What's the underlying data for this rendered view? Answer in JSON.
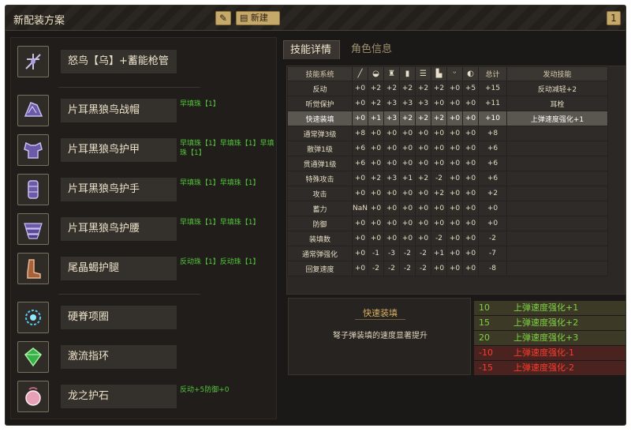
{
  "window": {
    "title": "新配装方案",
    "new_label": "新建",
    "count": "1"
  },
  "equipment": [
    {
      "name": "怒鸟【乌】+蓄能枪管",
      "deco": "",
      "icon": "weapon-bowgun-icon"
    },
    {
      "name": "片耳黑狼鸟战帽",
      "deco": "早填珠【1】",
      "icon": "helm-icon"
    },
    {
      "name": "片耳黑狼鸟护甲",
      "deco": "早填珠【1】早填珠【1】早填珠【1】",
      "icon": "chest-icon"
    },
    {
      "name": "片耳黑狼鸟护手",
      "deco": "早填珠【1】早填珠【1】",
      "icon": "arms-icon"
    },
    {
      "name": "片耳黑狼鸟护腰",
      "deco": "早填珠【1】早填珠【1】",
      "icon": "waist-icon"
    },
    {
      "name": "尾晶蝎护腿",
      "deco": "反动珠【1】反动珠【1】",
      "icon": "legs-icon"
    },
    {
      "name": "硬脊项圈",
      "deco": "",
      "icon": "necklace-icon"
    },
    {
      "name": "激流指环",
      "deco": "",
      "icon": "ring-icon"
    },
    {
      "name": "龙之护石",
      "deco": "反动+5防御+0",
      "icon": "talisman-icon"
    }
  ],
  "tabs": {
    "skill_details": "技能详情",
    "char_info": "角色信息"
  },
  "table": {
    "headers": {
      "skill_system": "技能系统",
      "total": "总计",
      "activated": "发动技能"
    },
    "header_icons": [
      "weapon-icon",
      "helm-icon",
      "chest-icon",
      "arms-icon",
      "waist-icon",
      "legs-icon",
      "necklace-icon",
      "ring-icon"
    ],
    "rows": [
      {
        "skill": "反动",
        "vals": [
          "+0",
          "+2",
          "+2",
          "+2",
          "+2",
          "+2",
          "+0",
          "+5"
        ],
        "total": "+15",
        "active": "反动减轻+2",
        "selected": false
      },
      {
        "skill": "听觉保护",
        "vals": [
          "+0",
          "+2",
          "+3",
          "+3",
          "+3",
          "+0",
          "+0",
          "+0"
        ],
        "total": "+11",
        "active": "耳栓",
        "selected": false
      },
      {
        "skill": "快速装填",
        "vals": [
          "+0",
          "+1",
          "+3",
          "+2",
          "+2",
          "+2",
          "+0",
          "+0"
        ],
        "total": "+10",
        "active": "上弹速度强化+1",
        "selected": true
      },
      {
        "skill": "通常弹3级",
        "vals": [
          "+8",
          "+0",
          "+0",
          "+0",
          "+0",
          "+0",
          "+0",
          "+0"
        ],
        "total": "+8",
        "active": "",
        "selected": false
      },
      {
        "skill": "散弹1级",
        "vals": [
          "+6",
          "+0",
          "+0",
          "+0",
          "+0",
          "+0",
          "+0",
          "+0"
        ],
        "total": "+6",
        "active": "",
        "selected": false
      },
      {
        "skill": "贯通弹1级",
        "vals": [
          "+6",
          "+0",
          "+0",
          "+0",
          "+0",
          "+0",
          "+0",
          "+0"
        ],
        "total": "+6",
        "active": "",
        "selected": false
      },
      {
        "skill": "特殊攻击",
        "vals": [
          "+0",
          "+2",
          "+3",
          "+1",
          "+2",
          "-2",
          "+0",
          "+0"
        ],
        "total": "+6",
        "active": "",
        "selected": false
      },
      {
        "skill": "攻击",
        "vals": [
          "+0",
          "+0",
          "+0",
          "+0",
          "+0",
          "+2",
          "+0",
          "+0"
        ],
        "total": "+2",
        "active": "",
        "selected": false
      },
      {
        "skill": "蓄力",
        "vals": [
          "NaN",
          "+0",
          "+0",
          "+0",
          "+0",
          "+0",
          "+0",
          "+0"
        ],
        "total": "+0",
        "active": "",
        "selected": false
      },
      {
        "skill": "防御",
        "vals": [
          "+0",
          "+0",
          "+0",
          "+0",
          "+0",
          "+0",
          "+0",
          "+0"
        ],
        "total": "+0",
        "active": "",
        "selected": false
      },
      {
        "skill": "装填数",
        "vals": [
          "+0",
          "+0",
          "+0",
          "+0",
          "+0",
          "-2",
          "+0",
          "+0"
        ],
        "total": "-2",
        "active": "",
        "selected": false
      },
      {
        "skill": "通常弹强化",
        "vals": [
          "+0",
          "-1",
          "-3",
          "-2",
          "-2",
          "+1",
          "+0",
          "+0"
        ],
        "total": "-7",
        "active": "",
        "selected": false
      },
      {
        "skill": "回复速度",
        "vals": [
          "+0",
          "-2",
          "-2",
          "-2",
          "-2",
          "+0",
          "+0",
          "+0"
        ],
        "total": "-8",
        "active": "",
        "selected": false
      }
    ]
  },
  "detail": {
    "title": "快速装填",
    "desc": "弩子弹装填的速度显著提升"
  },
  "activations": [
    {
      "pts": "10",
      "name": "上弹速度强化+1",
      "kind": "pos"
    },
    {
      "pts": "15",
      "name": "上弹速度强化+2",
      "kind": "pos"
    },
    {
      "pts": "20",
      "name": "上弹速度强化+3",
      "kind": "pos"
    },
    {
      "pts": "-10",
      "name": "上弹速度强化-1",
      "kind": "neg"
    },
    {
      "pts": "-15",
      "name": "上弹速度强化-2",
      "kind": "neg"
    }
  ]
}
